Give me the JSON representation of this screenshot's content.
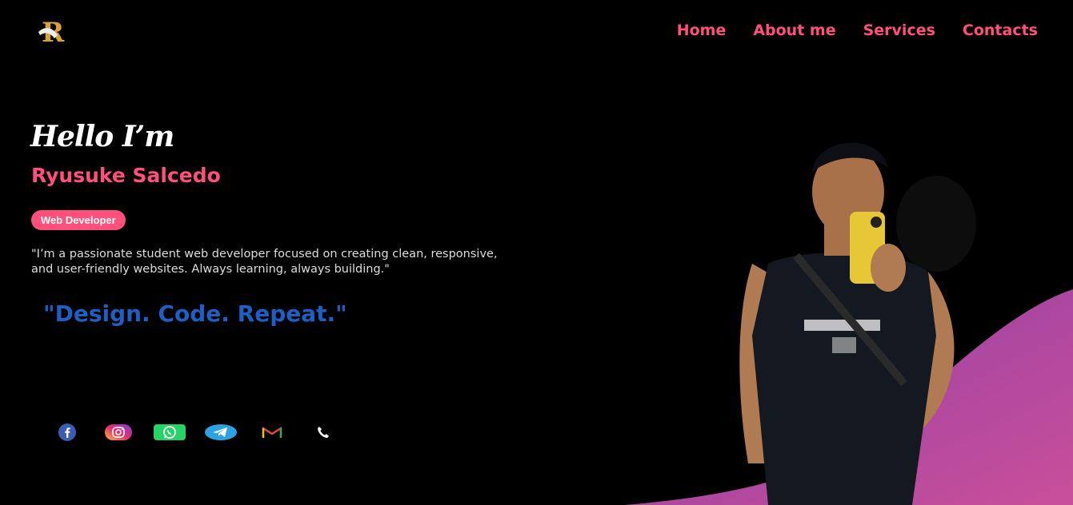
{
  "header": {
    "nav": [
      "Home",
      "About me",
      "Services",
      "Contacts"
    ],
    "logo_icon": "R-monogram-logo"
  },
  "hero": {
    "greeting": "Hello I’m",
    "name": "Ryusuke Salcedo",
    "role": "Web Developer",
    "bio": "\"I’m a passionate student web developer focused on creating clean, responsive, and user-friendly websites. Always learning, always building.\"",
    "tagline": "\"Design. Code. Repeat.\""
  },
  "socials": [
    {
      "icon": "facebook-icon"
    },
    {
      "icon": "instagram-icon"
    },
    {
      "icon": "whatsapp-icon"
    },
    {
      "icon": "telegram-icon"
    },
    {
      "icon": "gmail-icon"
    },
    {
      "icon": "phone-icon"
    }
  ],
  "colors": {
    "accent": "#ff4f7b",
    "tagline": "#1d5fc4",
    "background": "#000000",
    "wave_start": "#8e3fa6",
    "wave_end": "#c94f9a"
  }
}
